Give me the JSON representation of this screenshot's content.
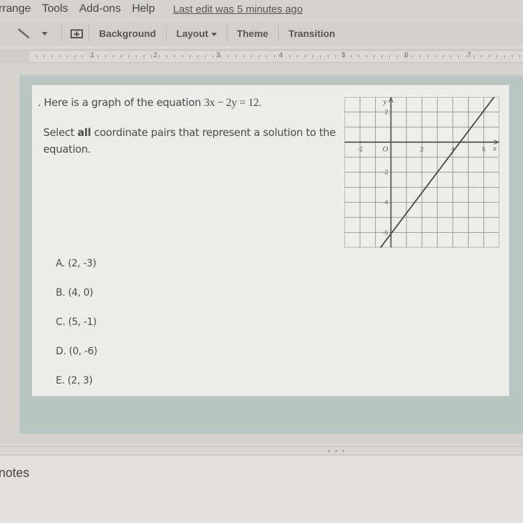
{
  "menubar": {
    "items": [
      "rrange",
      "Tools",
      "Add-ons",
      "Help"
    ],
    "last_edit": "Last edit was 5 minutes ago"
  },
  "toolbar": {
    "icons": [
      "line-icon",
      "caret-down-icon",
      "comment-icon"
    ],
    "background_label": "Background",
    "layout_label": "Layout",
    "theme_label": "Theme",
    "transition_label": "Transition"
  },
  "ruler": {
    "numbers": [
      "1",
      "2",
      "3",
      "4",
      "5",
      "6",
      "7"
    ]
  },
  "slide": {
    "question_prefix": ". Here is a graph of the equation ",
    "equation": "3x − 2y = 12.",
    "instruction_pre": "Select ",
    "instruction_bold": "all",
    "instruction_post": " coordinate pairs that represent a solution to the equation.",
    "options": [
      {
        "label": "A. (2, -3)"
      },
      {
        "label": "B. (4, 0)"
      },
      {
        "label": "C. (5, -1)"
      },
      {
        "label": "D. (0, -6)"
      },
      {
        "label": "E. (2, 3)"
      }
    ]
  },
  "graph": {
    "equation": "3x - 2y = 12",
    "x_range": [
      -3,
      7
    ],
    "y_range": [
      -7,
      3
    ],
    "x_axis_label": "x",
    "y_axis_label": "y",
    "origin_label": "O",
    "x_tick_labels": [
      {
        "value": -2,
        "text": "-2"
      },
      {
        "value": 2,
        "text": "2"
      },
      {
        "value": 4,
        "text": "4"
      },
      {
        "value": 6,
        "text": "6"
      }
    ],
    "y_tick_labels": [
      {
        "value": 2,
        "text": "2"
      },
      {
        "value": -2,
        "text": "-2"
      },
      {
        "value": -4,
        "text": "-4"
      },
      {
        "value": -6,
        "text": "-6"
      }
    ],
    "line_points": [
      [
        -0.67,
        -7
      ],
      [
        6.67,
        3
      ]
    ]
  },
  "notes": {
    "label": "notes",
    "handle": "• • •"
  }
}
